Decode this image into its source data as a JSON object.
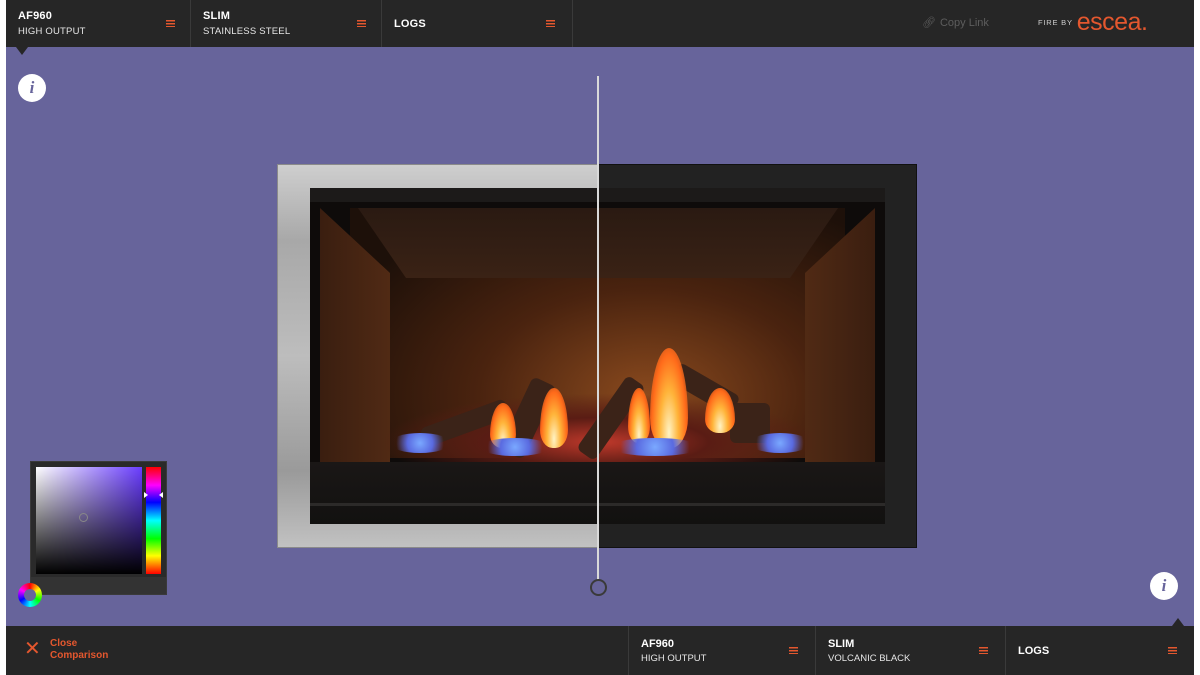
{
  "top_bar": {
    "segments": [
      {
        "title": "AF960",
        "subtitle": "HIGH OUTPUT"
      },
      {
        "title": "SLIM",
        "subtitle": "STAINLESS STEEL"
      },
      {
        "title": "LOGS"
      }
    ],
    "copy_link_label": "Copy Link",
    "brand_prefix": "FIRE BY",
    "brand_name": "escea."
  },
  "info_button_label": "i",
  "bottom_bar": {
    "close_comparison_line1": "Close",
    "close_comparison_line2": "Comparison",
    "close_icon": "✕",
    "segments": [
      {
        "title": "AF960",
        "subtitle": "HIGH OUTPUT"
      },
      {
        "title": "SLIM",
        "subtitle": "VOLCANIC BLACK"
      },
      {
        "title": "LOGS"
      }
    ]
  },
  "colors": {
    "background": "#67649b",
    "bar": "#262626",
    "accent": "#e4572e"
  },
  "icons": {
    "menu": "menu-icon",
    "link": "link-icon",
    "info": "info-icon",
    "close": "close-icon",
    "color_wheel": "color-wheel-icon"
  }
}
